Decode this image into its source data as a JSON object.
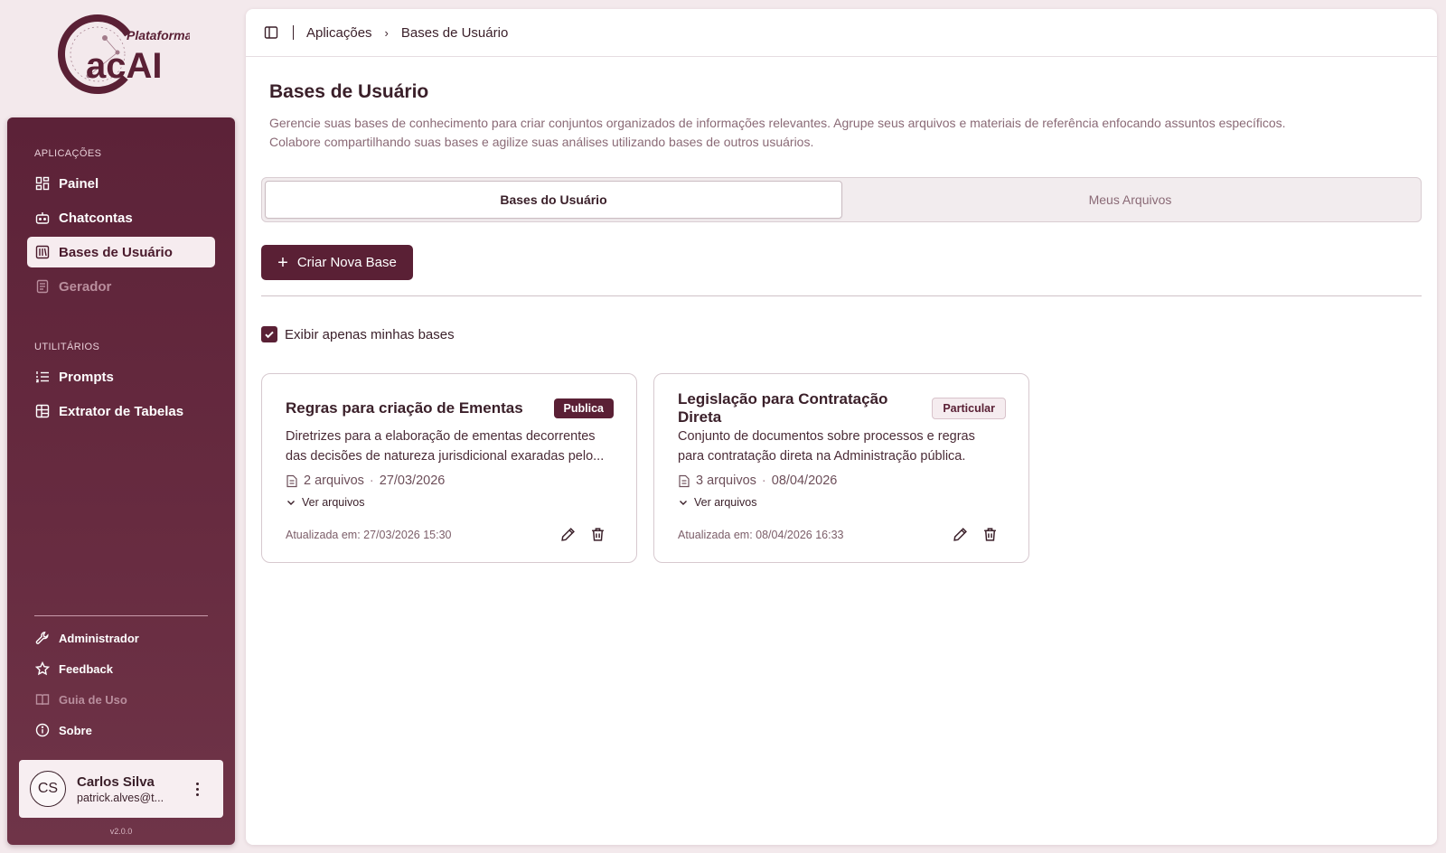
{
  "brand": {
    "logo_top": "Plataforma",
    "logo_main": "acAI"
  },
  "sidebar": {
    "section_apps": "APLICAÇÕES",
    "apps": [
      {
        "label": "Painel",
        "icon": "dashboard-icon",
        "state": "normal"
      },
      {
        "label": "Chatcontas",
        "icon": "bot-icon",
        "state": "normal"
      },
      {
        "label": "Bases de Usuário",
        "icon": "library-icon",
        "state": "active"
      },
      {
        "label": "Gerador",
        "icon": "document-icon",
        "state": "disabled"
      }
    ],
    "section_utils": "UTILITÁRIOS",
    "utils": [
      {
        "label": "Prompts",
        "icon": "list-ordered-icon"
      },
      {
        "label": "Extrator de Tabelas",
        "icon": "table-icon"
      }
    ],
    "bottom": [
      {
        "label": "Administrador",
        "icon": "wrench-icon",
        "state": "normal"
      },
      {
        "label": "Feedback",
        "icon": "star-icon",
        "state": "normal"
      },
      {
        "label": "Guia de Uso",
        "icon": "book-icon",
        "state": "disabled"
      },
      {
        "label": "Sobre",
        "icon": "info-icon",
        "state": "normal"
      }
    ],
    "user": {
      "initials": "CS",
      "name": "Carlos Silva",
      "email": "patrick.alves@t..."
    },
    "version": "v2.0.0"
  },
  "breadcrumb": {
    "root": "Aplicações",
    "current": "Bases de Usuário"
  },
  "page": {
    "title": "Bases de Usuário",
    "description_line1": "Gerencie suas bases de conhecimento para criar conjuntos organizados de informações relevantes. Agrupe seus arquivos e materiais de referência enfocando assuntos específicos.",
    "description_line2": "Colabore compartilhando suas bases e agilize suas análises utilizando bases de outros usuários."
  },
  "tabs": [
    {
      "label": "Bases do Usuário",
      "active": true
    },
    {
      "label": "Meus Arquivos",
      "active": false
    }
  ],
  "create_button": "Criar Nova Base",
  "filter": {
    "label": "Exibir apenas minhas bases",
    "checked": true
  },
  "cards": [
    {
      "title": "Regras para criação de Ementas",
      "badge": "Publica",
      "badge_type": "public",
      "desc_line1": "Diretrizes para a elaboração de ementas decorrentes",
      "desc_line2": "das decisões de natureza jurisdicional exaradas pelo...",
      "files": "2 arquivos",
      "date": "27/03/2026",
      "view_files": "Ver arquivos",
      "updated": "Atualizada em: 27/03/2026 15:30"
    },
    {
      "title": "Legislação para Contratação Direta",
      "badge": "Particular",
      "badge_type": "private",
      "desc_line1": "Conjunto de documentos sobre processos e regras",
      "desc_line2": "para contratação direta na Administração pública.",
      "files": "3 arquivos",
      "date": "08/04/2026",
      "view_files": "Ver arquivos",
      "updated": "Atualizada em: 08/04/2026 16:33"
    }
  ],
  "colors": {
    "brand": "#5a2035",
    "sidebar": "#5c2238",
    "muted_text": "#8a6a76"
  }
}
